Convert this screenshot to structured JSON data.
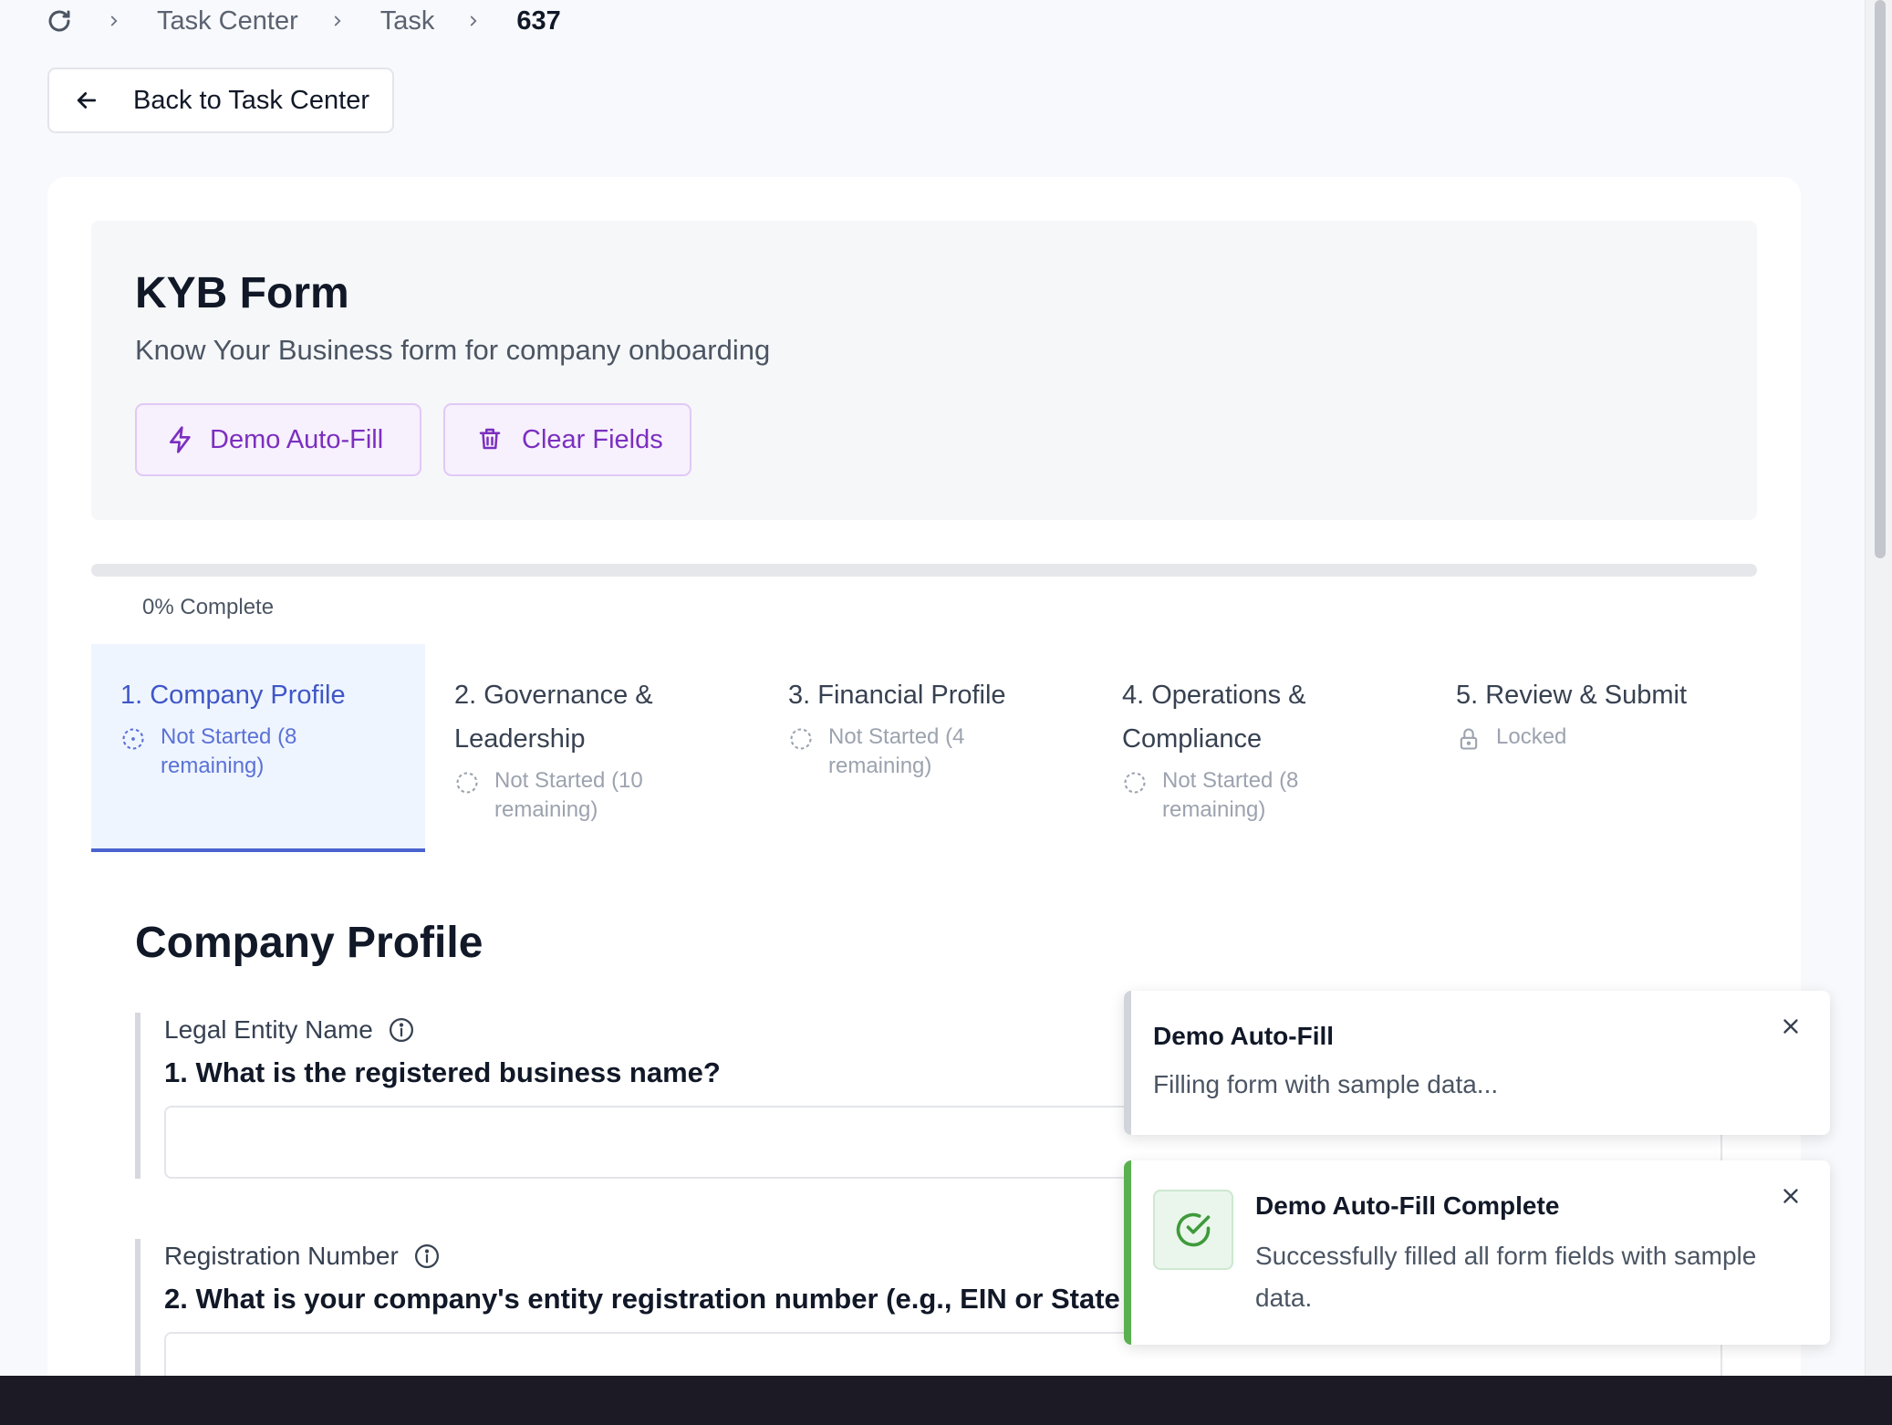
{
  "breadcrumb": {
    "items": [
      "Task Center",
      "Task"
    ],
    "current": "637"
  },
  "back_button": {
    "label": "Back to Task Center"
  },
  "form": {
    "title": "KYB Form",
    "subtitle": "Know Your Business form for company onboarding",
    "autofill_label": "Demo Auto-Fill",
    "clear_label": "Clear Fields"
  },
  "progress": {
    "percent": 0,
    "label": "0% Complete"
  },
  "steps": [
    {
      "label": "1. Company Profile",
      "status": "Not Started (8 remaining)",
      "state": "active"
    },
    {
      "label": "2. Governance & Leadership",
      "status": "Not Started (10 remaining)",
      "state": "pending"
    },
    {
      "label": "3. Financial Profile",
      "status": "Not Started (4 remaining)",
      "state": "pending"
    },
    {
      "label": "4. Operations & Compliance",
      "status": "Not Started (8 remaining)",
      "state": "pending"
    },
    {
      "label": "5. Review & Submit",
      "status": "Locked",
      "state": "locked"
    }
  ],
  "section": {
    "title": "Company Profile",
    "questions": [
      {
        "field": "Legal Entity Name",
        "text": "1. What is the registered business name?",
        "value": ""
      },
      {
        "field": "Registration Number",
        "text": "2. What is your company's entity registration number (e.g., EIN or State",
        "value": ""
      }
    ]
  },
  "toasts": [
    {
      "title": "Demo Auto-Fill",
      "body": "Filling form with sample data..."
    },
    {
      "title": "Demo Auto-Fill Complete",
      "body": "Successfully filled all form fields with sample data."
    }
  ],
  "colors": {
    "accent": "#4a63cf",
    "purple": "#7b2fbf",
    "success": "#5ab04f"
  }
}
